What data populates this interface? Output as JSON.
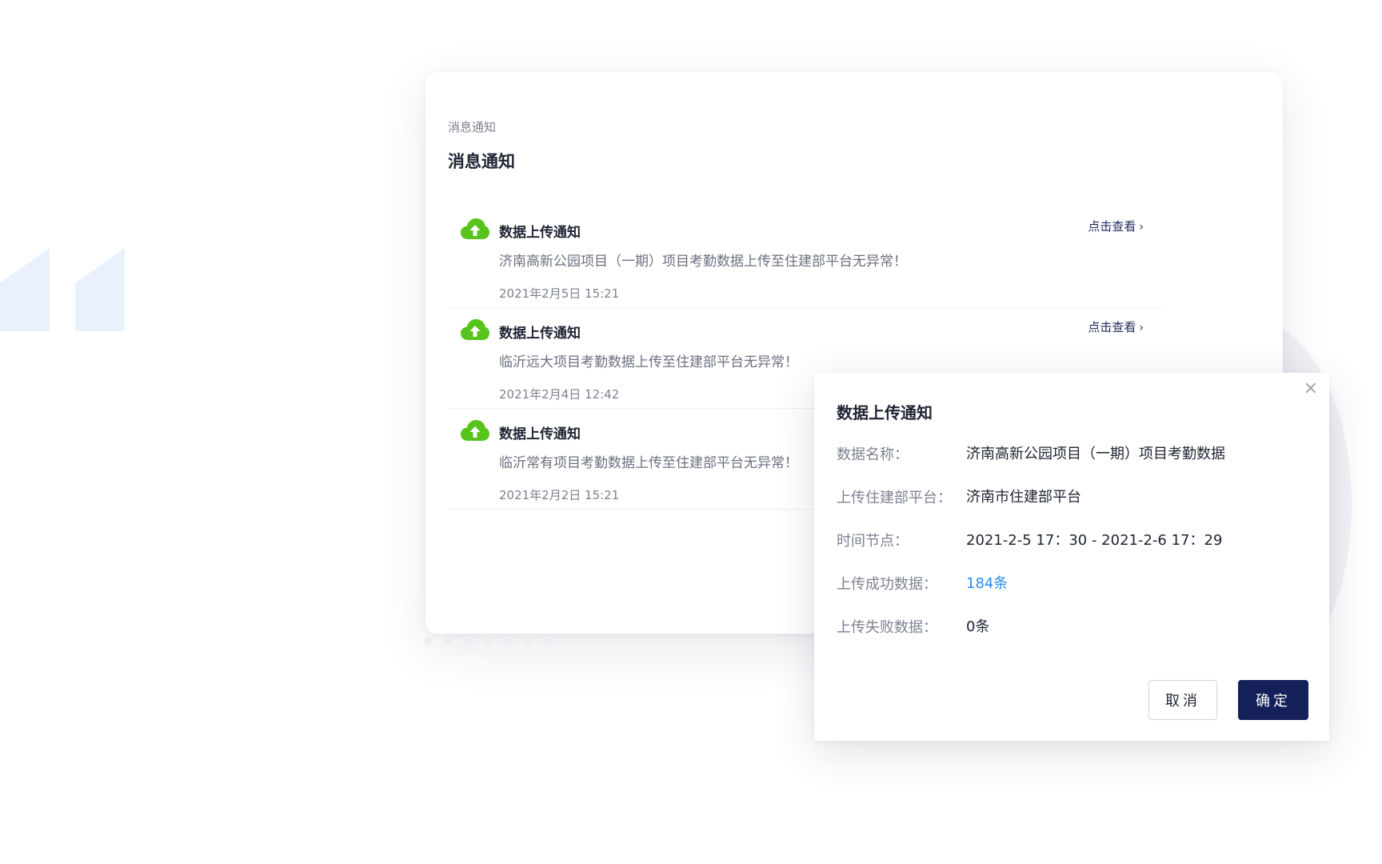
{
  "page": {
    "breadcrumb": "消息通知",
    "title": "消息通知"
  },
  "notifications": [
    {
      "title": "数据上传通知",
      "description": "济南高新公园项目（一期）项目考勤数据上传至住建部平台无异常！",
      "time": "2021年2月5日  15:21",
      "link_label": "点击查看",
      "icon": "cloud-upload-icon"
    },
    {
      "title": "数据上传通知",
      "description": "临沂远大项目考勤数据上传至住建部平台无异常！",
      "time": "2021年2月4日  12:42",
      "link_label": "点击查看",
      "icon": "cloud-upload-icon"
    },
    {
      "title": "数据上传通知",
      "description": "临沂常有项目考勤数据上传至住建部平台无异常！",
      "time": "2021年2月2日  15:21",
      "icon": "cloud-upload-icon"
    }
  ],
  "modal": {
    "title": "数据上传通知",
    "rows": [
      {
        "label": "数据名称：",
        "value": "济南高新公园项目（一期）项目考勤数据"
      },
      {
        "label": "上传住建部平台：",
        "value": "济南市住建部平台"
      },
      {
        "label": "时间节点：",
        "value": "2021-2-5 17：30  -  2021-2-6  17：29"
      },
      {
        "label": "上传成功数据：",
        "value": "184条"
      },
      {
        "label": "上传失败数据：",
        "value": "0条"
      }
    ],
    "cancel_label": "取消",
    "confirm_label": "确定"
  },
  "colors": {
    "accent_navy": "#14205a",
    "icon_green": "#56c41a",
    "link_blue": "#2a8cf0",
    "decor_blue": "#e9f1fd"
  }
}
